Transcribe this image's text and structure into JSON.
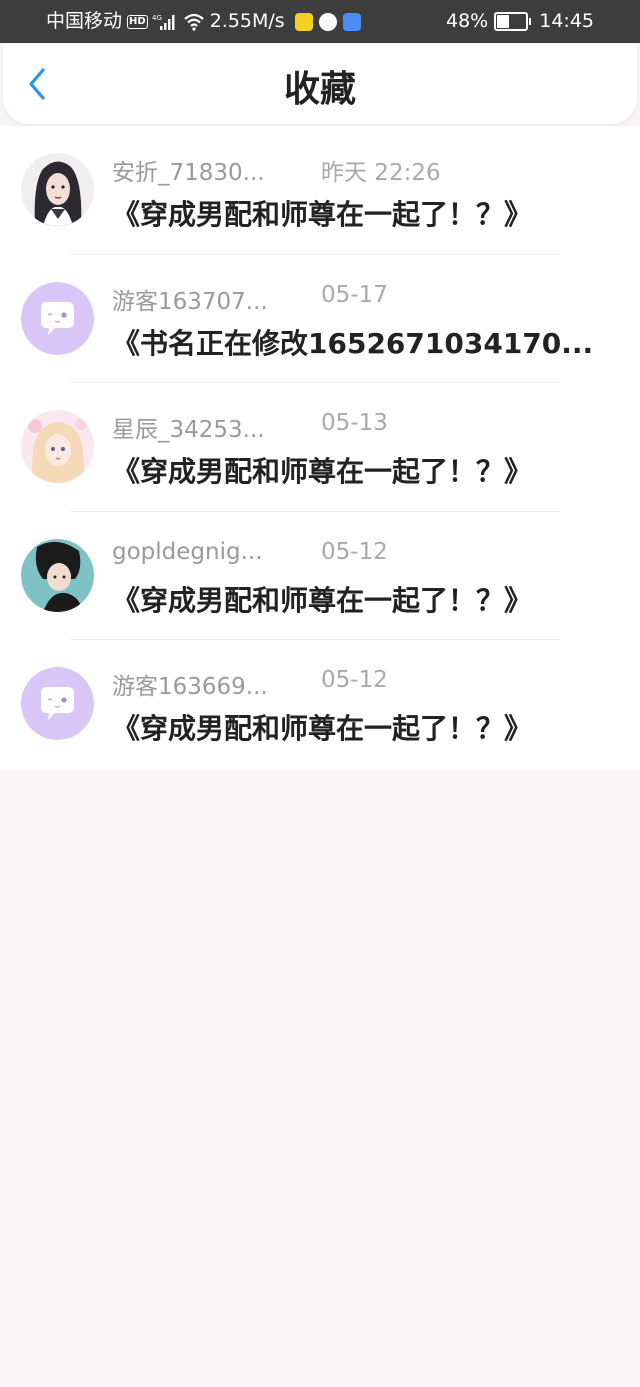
{
  "status_bar": {
    "carrier": "中国移动",
    "hd_badge": "HD",
    "network": "4G",
    "speed": "2.55M/s",
    "battery_pct": "48%",
    "battery_level": 0.48,
    "time": "14:45"
  },
  "header": {
    "title": "收藏",
    "back_icon": "chevron-left-icon",
    "accent": "#2196f3"
  },
  "favorites": [
    {
      "username": "安折_71830...",
      "time": "昨天 22:26",
      "title": "《穿成男配和师尊在一起了！？》",
      "avatar": "anime-girl-dark-hair"
    },
    {
      "username": "游客163707...",
      "time": "05-17",
      "title": "《书名正在修改1652671034170...",
      "avatar": "default-chat-bubble"
    },
    {
      "username": "星辰_34253...",
      "time": "05-13",
      "title": "《穿成男配和师尊在一起了！？》",
      "avatar": "anime-girl-pink"
    },
    {
      "username": "gopldegnig...",
      "time": "05-12",
      "title": "《穿成男配和师尊在一起了！？》",
      "avatar": "anime-boy-teal"
    },
    {
      "username": "游客163669...",
      "time": "05-12",
      "title": "《穿成男配和师尊在一起了！？》",
      "avatar": "default-chat-bubble"
    }
  ]
}
